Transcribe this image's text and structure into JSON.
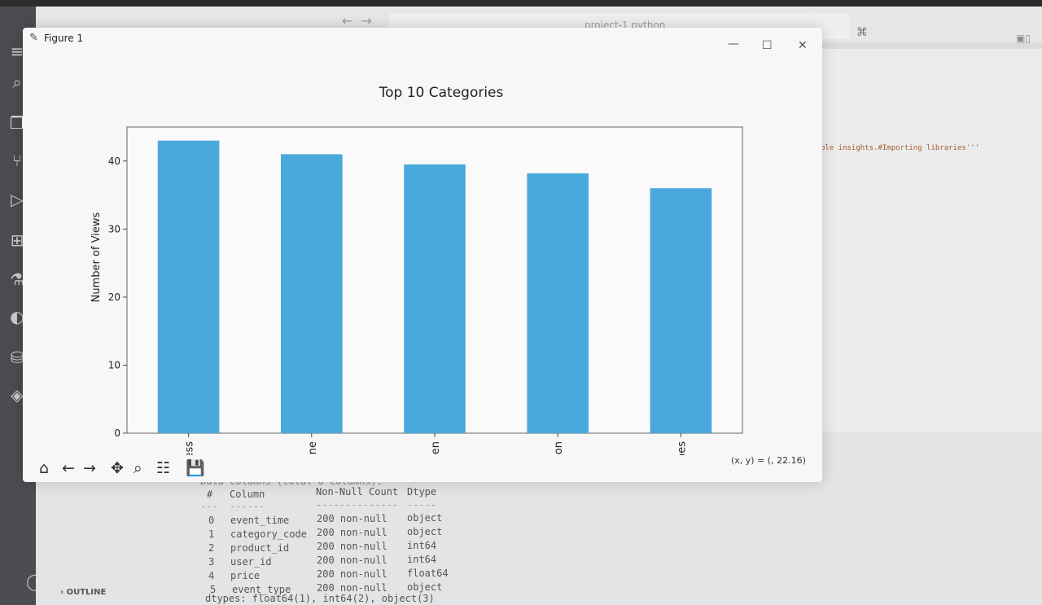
{
  "editor": {
    "search_placeholder": "project-1 python",
    "code_snippet": "ble insights.#Importing libraries'''",
    "outline_label": "OUTLINE"
  },
  "terminal": {
    "header_partial": "Data columns (total 6 columns):",
    "headers": [
      "#",
      "Column",
      "Non-Null Count",
      "Dtype"
    ],
    "dashes": [
      "---",
      "------",
      "--------------",
      "-----"
    ],
    "rows": [
      [
        "0",
        "event_time",
        "200 non-null",
        "object"
      ],
      [
        "1",
        "category_code",
        "200 non-null",
        "object"
      ],
      [
        "2",
        "product_id",
        "200 non-null",
        "int64"
      ],
      [
        "3",
        "user_id",
        "200 non-null",
        "int64"
      ],
      [
        "4",
        "price",
        "200 non-null",
        "float64"
      ],
      [
        "5",
        "event_type",
        "200 non-null",
        "object"
      ]
    ],
    "dtypes_line": "dtypes: float64(1), int64(2), object(3)"
  },
  "figure": {
    "window_title": "Figure 1",
    "coords_readout": "(x, y) = (, 22.16)",
    "toolbar_icons": [
      "home-icon",
      "back-icon",
      "forward-icon",
      "pan-icon",
      "zoom-icon",
      "configure-icon",
      "save-icon"
    ]
  },
  "chart_data": {
    "type": "bar",
    "title": "Top 10 Categories",
    "xlabel": "",
    "ylabel": "Number of Views",
    "categories": [
      "itness",
      "phone",
      "itchen",
      "fiction",
      "shoes"
    ],
    "values": [
      43,
      41,
      39.5,
      38.2,
      36
    ],
    "ylim": [
      0,
      45
    ],
    "yticks": [
      0,
      10,
      20,
      30,
      40
    ],
    "bar_color": "#4aa9dc",
    "grid": false,
    "legend": "none"
  }
}
